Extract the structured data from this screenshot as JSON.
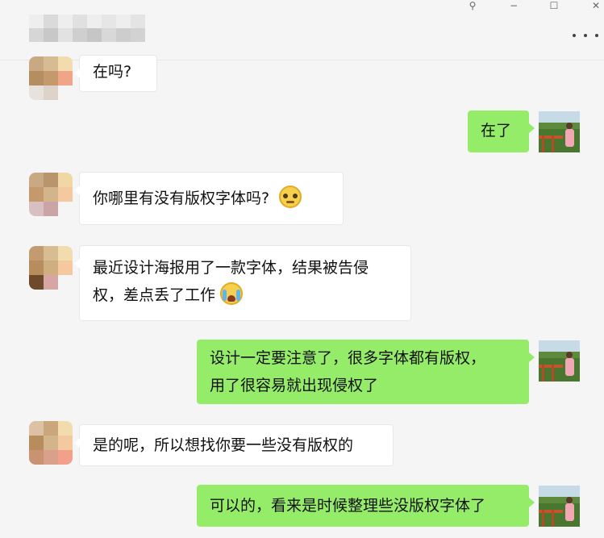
{
  "window": {
    "pin_glyph": "⚲",
    "minimize_glyph": "−",
    "maximize_glyph": "☐",
    "close_glyph": "✕"
  },
  "messages": [
    {
      "side": "in",
      "text": "在吗?"
    },
    {
      "side": "out",
      "text": "在了"
    },
    {
      "side": "in",
      "text": "你哪里有没有版权字体吗?",
      "emoji": "blush-face-icon"
    },
    {
      "side": "in",
      "lines": [
        "最近设计海报用了一款字体，结果被告侵",
        "权，差点丢了工作"
      ],
      "emoji": "crying-face-icon"
    },
    {
      "side": "out",
      "lines": [
        "设计一定要注意了，很多字体都有版权，",
        "用了很容易就出现侵权了"
      ]
    },
    {
      "side": "in",
      "text": "是的呢，所以想找你要一些没有版权的"
    },
    {
      "side": "out",
      "text": "可以的，看来是时候整理些没版权字体了"
    }
  ],
  "colors": {
    "background": "#f5f5f5",
    "incoming_bubble": "#ffffff",
    "outgoing_bubble": "#95ec69"
  }
}
